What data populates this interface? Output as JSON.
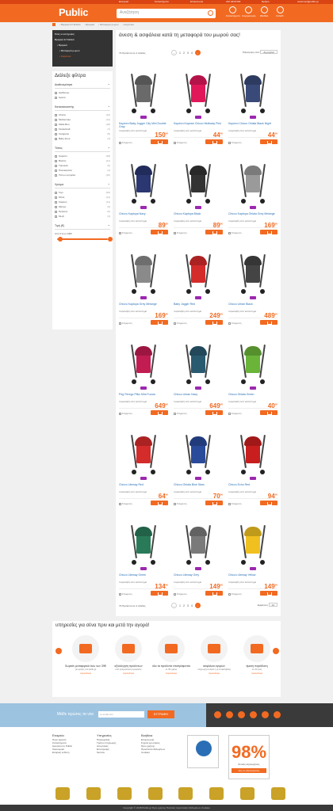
{
  "topbar": {
    "items": [
      "Ελληνικά",
      "Καταστήματα",
      "Επικοινωνία",
      "210 1818 000",
      "Ωράριο",
      "customer@public.gr"
    ]
  },
  "header": {
    "logo": "Public",
    "search_placeholder": "Αναζήτηση",
    "icons": [
      {
        "icon": "stores-icon",
        "label": "Καταστήματα"
      },
      {
        "icon": "user-icon",
        "label": "Λογαριασμός"
      },
      {
        "icon": "wishlist-icon",
        "label": "Wishlist"
      },
      {
        "icon": "cart-icon",
        "label": "Καλάθι"
      }
    ]
  },
  "breadcrumb": [
    "Βρεφικά & Παιδικά",
    "Βρεφικά",
    "Μεταφορά μωρού",
    "Καρότσια"
  ],
  "sidebar": {
    "categories": [
      "Όλες οι κατηγορίες",
      "Βρεφικά & Παιδικά",
      "Βρεφικά",
      "Μεταφορά μωρού",
      "Καρότσια"
    ],
    "filters_title": "Διάλεξε φίλτρα",
    "groups": [
      {
        "title": "Διαθεσιμότητα",
        "options": [
          {
            "label": "Διαθέσιμο",
            "count": ""
          },
          {
            "label": "Άμεσα",
            "count": ""
          }
        ]
      },
      {
        "title": "Κατασκευαστής",
        "options": [
          {
            "label": "Chicco",
            "count": "(10)"
          },
          {
            "label": "Mothercare",
            "count": "(14)"
          },
          {
            "label": "Kikka Boo",
            "count": "(18)"
          },
          {
            "label": "Kinderkraft",
            "count": "(7)"
          },
          {
            "label": "Cangaroo",
            "count": "(8)"
          },
          {
            "label": "Baby Zone",
            "count": "(3)"
          }
        ]
      },
      {
        "title": "Τύπος",
        "options": [
          {
            "label": "Καρότσι",
            "count": "(48)"
          },
          {
            "label": "Βόλτας",
            "count": "(21)"
          },
          {
            "label": "Τρίκυκλο",
            "count": "(5)"
          },
          {
            "label": "Πολυκαρότσι",
            "count": "(4)"
          },
          {
            "label": "Τύπου ομπρέλα",
            "count": "(16)"
          }
        ]
      },
      {
        "title": "Χρώμα",
        "options": [
          {
            "label": "Γκρι",
            "count": "(20)"
          },
          {
            "label": "Μπλε",
            "count": "(12)"
          },
          {
            "label": "Κόκκινο",
            "count": "(11)"
          },
          {
            "label": "Μαύρο",
            "count": "(9)"
          },
          {
            "label": "Πράσινο",
            "count": "(6)"
          },
          {
            "label": "Μωβ",
            "count": "(3)"
          }
        ]
      }
    ],
    "price": {
      "title": "Τιμή (€)",
      "range": "Από 0 έως 1000",
      "min_fraction": 0.05,
      "max_fraction": 0.95
    }
  },
  "main": {
    "title": "άνεση & ασφάλεια κατά τη μεταφορά του μωρού σας!",
    "result_count": "73 Προϊόντα σε 4 σελίδες",
    "pagination": [
      "1",
      "2",
      "3",
      "4"
    ],
    "sort_label": "Ταξινόμηση ανά:",
    "sort_value": "Δημοφιλία",
    "show_label": "Εμφάνιση",
    "show_value": "24",
    "compare_label": "Σύγκριση",
    "available_label": "παραλαβή από κατάστημα",
    "products": [
      {
        "name": "Καρότσι Baby Jogger City Mini Double Gray",
        "price": "150",
        "cents": "90",
        "color": "#6a6a6a"
      },
      {
        "name": "Καρότσι Καρότσι Chicco Multiway Pink",
        "price": "44",
        "cents": "90",
        "color": "#e0185a"
      },
      {
        "name": "Καρότσι Chicco Ohlala Black Night",
        "price": "44",
        "cents": "90",
        "color": "#3a4a78"
      },
      {
        "name": "Chicco Kaptopa Navy",
        "price": "89",
        "cents": "90",
        "color": "#2a3770"
      },
      {
        "name": "Chicco Kaptopa Black",
        "price": "89",
        "cents": "90",
        "color": "#333333"
      },
      {
        "name": "Chicco Kaptopa Ohlala Grey Melange",
        "price": "169",
        "cents": "90",
        "color": "#9a9a9a"
      },
      {
        "name": "Chicco Kaptopa Grey Melange",
        "price": "169",
        "cents": "90",
        "color": "#8a8a8a"
      },
      {
        "name": "Baby Jogger Red",
        "price": "249",
        "cents": "90",
        "color": "#d42b2b"
      },
      {
        "name": "Chicco Urban Black",
        "price": "489",
        "cents": "90",
        "color": "#444444"
      },
      {
        "name": "Peg Perego Pliko Mini Fucsia",
        "price": "649",
        "cents": "90",
        "color": "#c21d52"
      },
      {
        "name": "Chicco Urban Navy",
        "price": "649",
        "cents": "90",
        "color": "#2a5a70"
      },
      {
        "name": "Chicco Ohlala Green",
        "price": "40",
        "cents": "90",
        "color": "#6bb43a"
      },
      {
        "name": "Chicco Liteway Red",
        "price": "64",
        "cents": "90",
        "color": "#d42b2b"
      },
      {
        "name": "Chicco Ohlala Blue Stars",
        "price": "70",
        "cents": "90",
        "color": "#2a4a9a"
      },
      {
        "name": "Chicco Echo Red",
        "price": "94",
        "cents": "90",
        "color": "#c81e1e"
      },
      {
        "name": "Chicco Liteway Green",
        "price": "134",
        "cents": "90",
        "color": "#2a7a5a"
      },
      {
        "name": "Chicco Liteway Grey",
        "price": "149",
        "cents": "90",
        "color": "#7a7a7a"
      },
      {
        "name": "Chicco Liteway Yellow",
        "price": "149",
        "cents": "90",
        "color": "#f0c020"
      }
    ]
  },
  "services": {
    "title": "υπηρεσίες για σένα πριν και μετά την αγορά!",
    "items": [
      {
        "icon": "truck-icon",
        "name": "δωρεάν μεταφορικά άνω των 39€",
        "desc": "για αγορές στο public.gr",
        "more": "περισσότερα"
      },
      {
        "icon": "shield-icon",
        "name": "αξιολόγηση προϊόντων",
        "desc": "από πραγματικούς αγοραστές",
        "more": "περισσότερα"
      },
      {
        "icon": "return-icon",
        "name": "όλα τα προϊόντα επιστρέφονται",
        "desc": "σε 30 ημέρες",
        "more": "περισσότερα"
      },
      {
        "icon": "card-icon",
        "name": "ασφάλεια αγορών",
        "desc": "πληρωμή με κάρτα ή με αντικαταβολή",
        "more": "περισσότερα"
      },
      {
        "icon": "clock-icon",
        "name": "άμεση παράδοση",
        "desc": "σε 24 ώρες",
        "more": "περισσότερα"
      }
    ]
  },
  "newsletter": {
    "label": "Μάθε πρώτος τα νέα",
    "placeholder": "το email σου",
    "button": "ΕΓΓΡΑΦΗ"
  },
  "footer": {
    "cols": [
      {
        "title": "Εταιρεία",
        "items": [
          "Ποιοι είμαστε",
          "Καταστήματα",
          "Δουλειά στο Public",
          "Οικονομικά",
          "Εταιρική ευθύνη"
        ]
      },
      {
        "title": "Υπηρεσίες",
        "items": [
          "Παραγγελίες",
          "Τρόποι πληρωμής",
          "Αποστολές",
          "Επιστροφές",
          "Service"
        ]
      },
      {
        "title": "Βοήθεια",
        "items": [
          "Επικοινωνία",
          "Συχνές ερωτήσεις",
          "Όροι χρήσης",
          "Προστασία δεδομένων",
          "Cookies"
        ]
      }
    ],
    "rating_percent": "98%",
    "rating_text": "θετικές αξιολογήσεις",
    "rating_button": "Δες τις αξιολογήσεις",
    "copyright": "Copyright © 2018 Public.gr   Όροι χρήσης   Πολιτική προστασίας δεδομένων   Cookies"
  },
  "colors": {
    "accent": "#f26a21",
    "dark": "#333333",
    "link": "#2a6fb5"
  }
}
